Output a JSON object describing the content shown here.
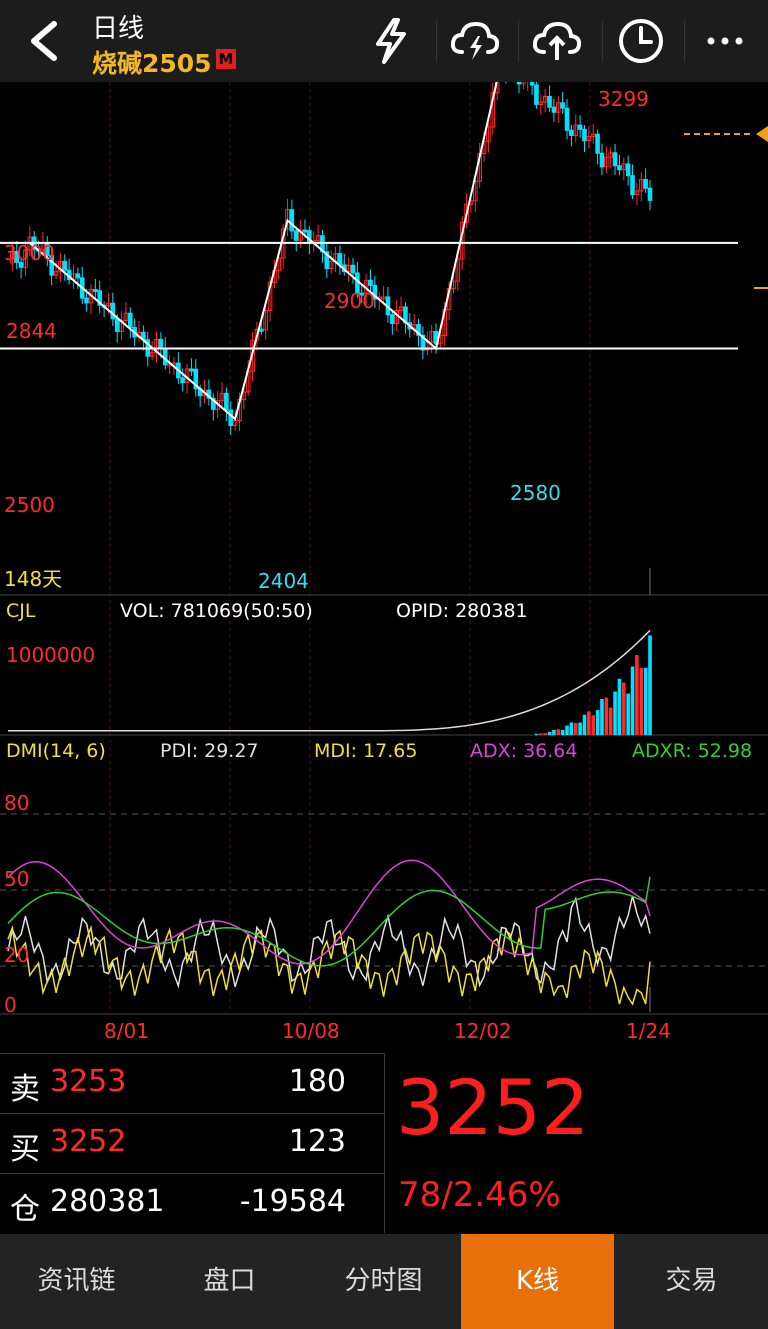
{
  "header": {
    "title": "日线",
    "symbol": "烧碱2505",
    "badge": "M"
  },
  "colors": {
    "up": "#ff2a2a",
    "down": "#00e0ff",
    "accent": "#e8700a",
    "symbol": "#f2b824"
  },
  "icons": [
    "back-arrow-icon",
    "lightning-icon",
    "cloud-lightning-icon",
    "cloud-upload-icon",
    "clock-icon",
    "more-icon"
  ],
  "chart_data": [
    {
      "type": "candlestick",
      "y_labels": [
        "3000",
        "2500"
      ],
      "ylim": [
        2404,
        3299
      ],
      "days_label": "148天",
      "annotations": [
        {
          "label": "2844",
          "value": 2844,
          "color": "red"
        },
        {
          "label": "2900",
          "value": 2900,
          "color": "red"
        },
        {
          "label": "2404",
          "value": 2404,
          "color": "cyan"
        },
        {
          "label": "2580",
          "value": 2580,
          "color": "cyan"
        },
        {
          "label": "3299",
          "value": 3299,
          "color": "red"
        }
      ],
      "horizontal_lines": [
        2844,
        2580
      ],
      "trendline": [
        2844,
        2404,
        2900,
        2580,
        3299
      ]
    },
    {
      "type": "bar",
      "indicator": "CJL",
      "vol_label": "VOL: 781069(50:50)",
      "opid_label": "OPID: 280381",
      "y_labels": [
        "1000000"
      ]
    },
    {
      "type": "line",
      "indicator": "DMI(14, 6)",
      "y_labels": [
        "80",
        "50",
        "20",
        "0"
      ],
      "ylim": [
        0,
        80
      ],
      "series": [
        {
          "name": "PDI",
          "label": "PDI: 29.27",
          "last": 29.27,
          "color": "#e0e0e0"
        },
        {
          "name": "MDI",
          "label": "MDI: 17.65",
          "last": 17.65,
          "color": "#f0e030"
        },
        {
          "name": "ADX",
          "label": "ADX: 36.64",
          "last": 36.64,
          "color": "#e040e0"
        },
        {
          "name": "ADXR",
          "label": "ADXR: 52.98",
          "last": 52.98,
          "color": "#30d030"
        }
      ],
      "x_labels": [
        "8/01",
        "10/08",
        "12/02",
        "1/24"
      ]
    }
  ],
  "quote": {
    "sell_label": "卖",
    "sell_price": "3253",
    "sell_vol": "180",
    "buy_label": "买",
    "buy_price": "3252",
    "buy_vol": "123",
    "oi_label": "仓",
    "oi_value": "280381",
    "oi_change": "-19584",
    "last_price": "3252",
    "change": "78/2.46%"
  },
  "tabs": [
    "资讯链",
    "盘口",
    "分时图",
    "K线",
    "交易"
  ],
  "active_tab": 3
}
